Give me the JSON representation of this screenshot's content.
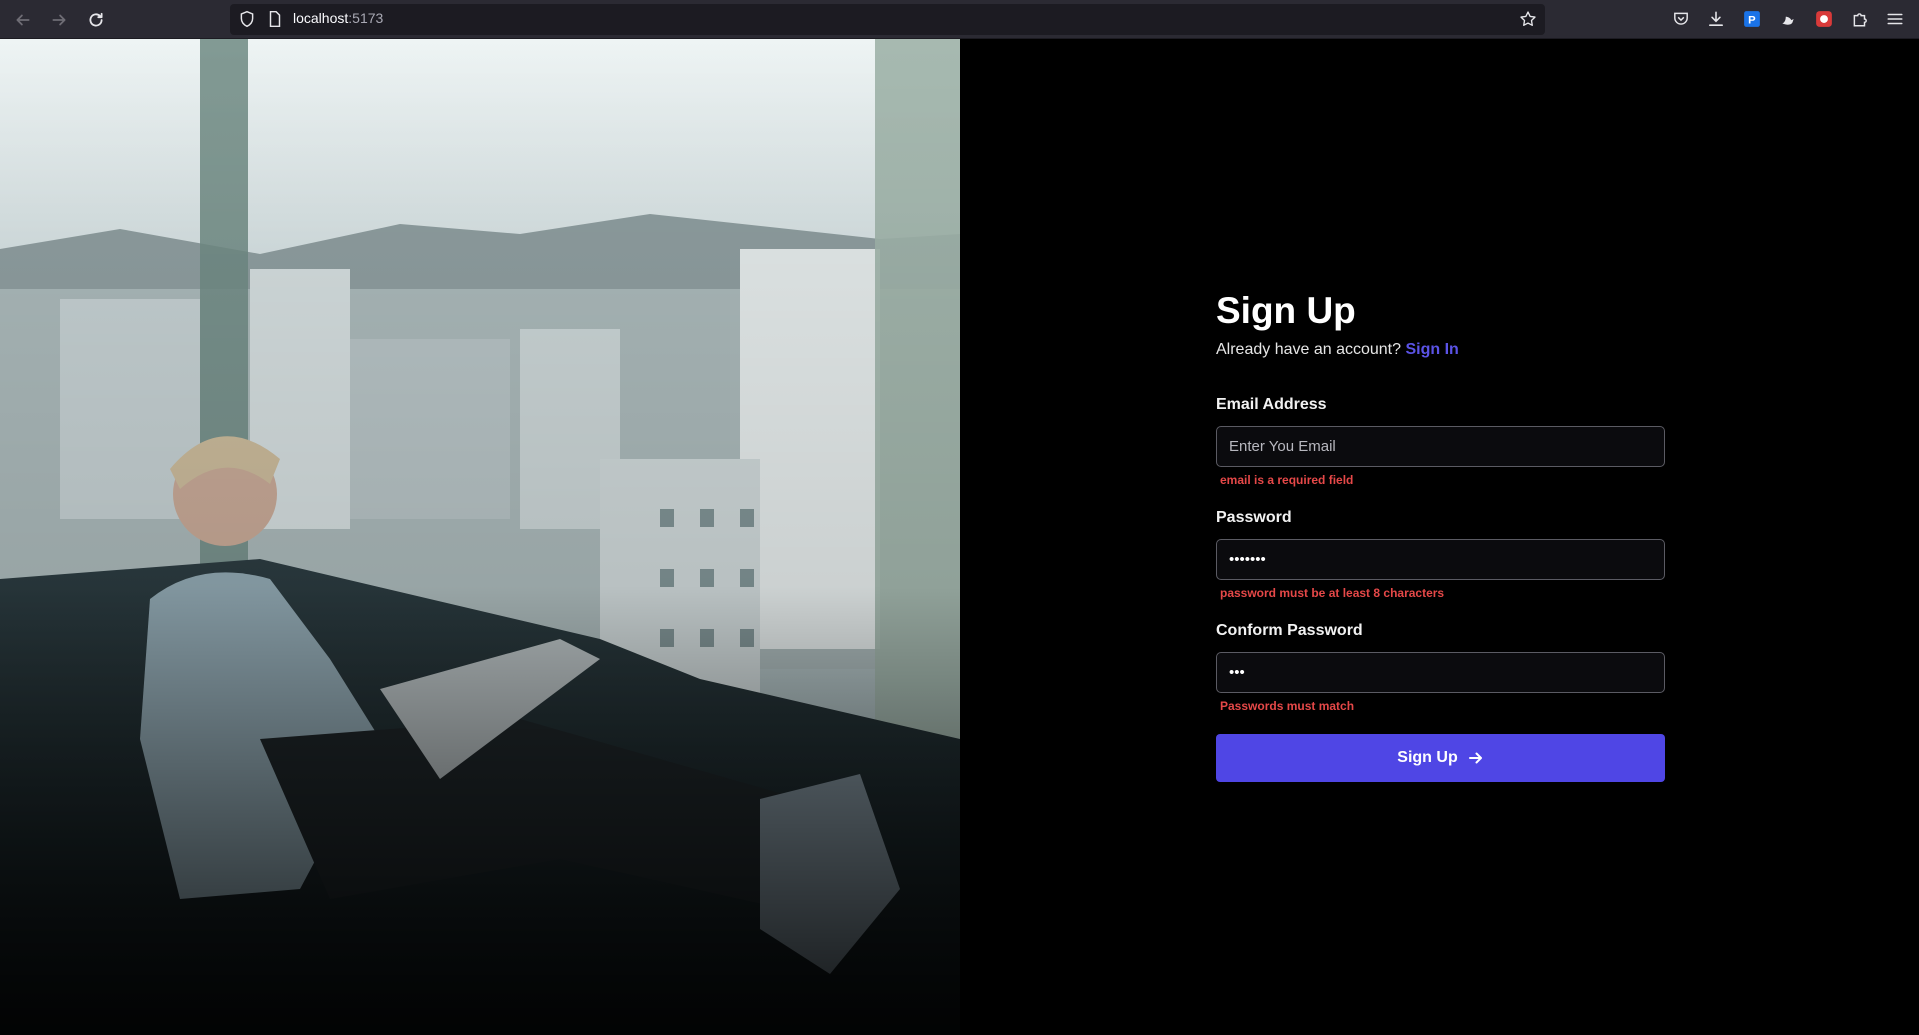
{
  "browser": {
    "url_host": "localhost",
    "url_port": ":5173",
    "back_icon": "arrow-left-icon",
    "forward_icon": "arrow-right-icon",
    "reload_icon": "reload-icon"
  },
  "form": {
    "title": "Sign Up",
    "subtitle_prefix": "Already have an account?",
    "signin_link": "Sign In",
    "email": {
      "label": "Email Address",
      "placeholder": "Enter You Email",
      "value": "",
      "error": "email is a required field"
    },
    "password": {
      "label": "Password",
      "value": "•••••••",
      "error": "password must be at least 8 characters"
    },
    "confirm": {
      "label": "Conform Password",
      "value": "•••",
      "error": "Passwords must match"
    },
    "submit_label": "Sign Up",
    "submit_icon": "arrow-right-icon",
    "accent_color": "#4f46e5",
    "error_color": "#e54848"
  }
}
